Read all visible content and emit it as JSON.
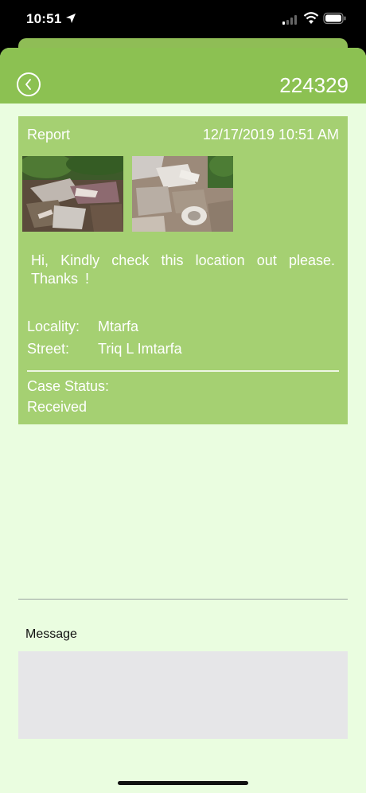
{
  "status_bar": {
    "time": "10:51",
    "icons": [
      "location-arrow-icon",
      "cellular-signal-icon",
      "wifi-icon",
      "battery-icon"
    ]
  },
  "nav": {
    "back_icon": "chevron-left-icon",
    "title": "224329"
  },
  "report": {
    "label": "Report",
    "date": "12/17/2019 10:51 AM",
    "photos": [
      "debris-photo",
      "rubble-toilet-photo"
    ],
    "message": "Hi, Kindly check this location out please. Thanks !",
    "locality_label": "Locality:",
    "locality_value": "Mtarfa",
    "street_label": "Street:",
    "street_value": "Triq L Imtarfa",
    "case_status_label": "Case Status:",
    "case_status_value": "Received"
  },
  "message_section": {
    "label": "Message",
    "value": ""
  },
  "colors": {
    "nav": "#8cc152",
    "card": "#a5d072",
    "background": "#eafde0",
    "input": "#e6e6e8"
  }
}
